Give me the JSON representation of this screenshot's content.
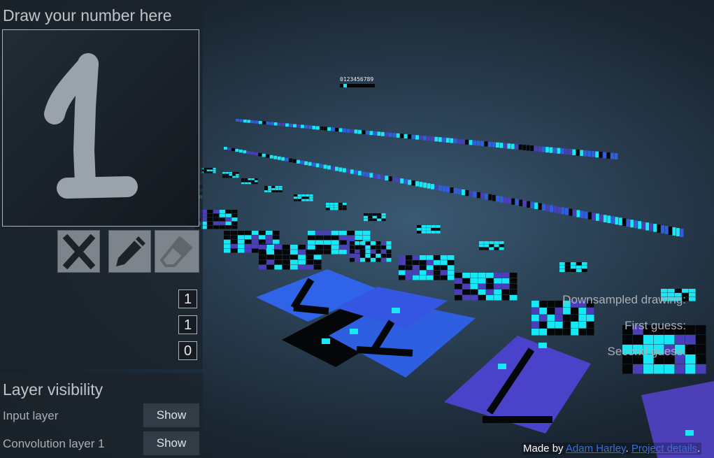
{
  "panel": {
    "title": "Draw your number here",
    "tools": [
      {
        "name": "clear",
        "icon": "x-icon"
      },
      {
        "name": "draw",
        "icon": "pencil-icon"
      },
      {
        "name": "erase",
        "icon": "eraser-icon"
      }
    ],
    "downsampled_label": "Downsampled drawing:",
    "downsampled_value": "1",
    "first_guess_label": "First guess:",
    "first_guess_value": "1",
    "second_guess_label": "Second guess:",
    "second_guess_value": "0"
  },
  "layers": {
    "title": "Layer visibility",
    "items": [
      {
        "label": "Input layer",
        "button": "Show"
      },
      {
        "label": "Convolution layer 1",
        "button": "Show"
      }
    ]
  },
  "scene": {
    "output_digits": "0123456789",
    "colors": {
      "cyan": "#18e8f6",
      "blue": "#2e5fe0",
      "violet": "#4a3fb8",
      "black": "#050608"
    }
  },
  "credit": {
    "prefix": "Made by ",
    "author": "Adam Harley",
    "sep": ". ",
    "link": "Project details",
    "end": "."
  }
}
